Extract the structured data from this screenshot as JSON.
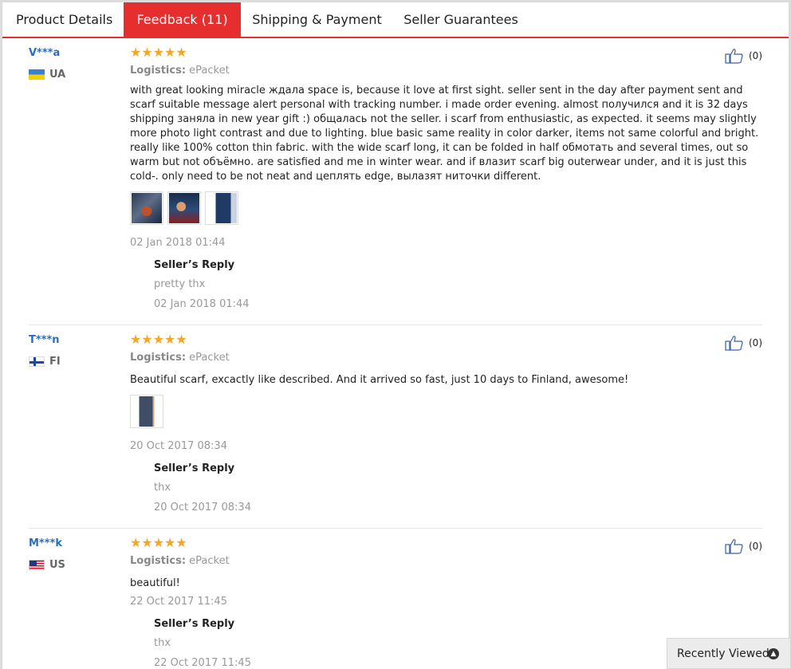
{
  "tabs": [
    {
      "label": "Product Details"
    },
    {
      "label": "Feedback (11)"
    },
    {
      "label": "Shipping & Payment"
    },
    {
      "label": "Seller Guarantees"
    }
  ],
  "reviews": [
    {
      "user": "V***a",
      "country": "UA",
      "stars": "★★★★★",
      "logistics_label": "Logistics:",
      "logistics_value": "ePacket",
      "text": "with great looking miracle ждала space is, because it love at first sight. seller sent in the day after payment sent and scarf suitable message alert personal with tracking number. i made order evening. almost получился and it is 32 days shipping заняла in new year gift :) общалась not the seller. i scarf from enthusiastic, as expected. it seems may slightly more photo light contrast and due to lighting. blue basic same reality in color darker, items not same colorful and bright. really like 100% cotton thin fabric. with the wide scarf long, it can be folded in half обмотать and several times, out so warm but not объёмно. are satisfied and me in winter wear. and if влазит scarf big outerwear under, and it is just this cold-. only need to be not neat and цеплять edge, вылазят ниточки different.",
      "date": "02 Jan 2018 01:44",
      "reply_title": "Seller’s Reply",
      "reply_text": "pretty thx",
      "reply_date": "02 Jan 2018 01:44",
      "helpful_count": "(0)"
    },
    {
      "user": "T***n",
      "country": "FI",
      "stars": "★★★★★",
      "logistics_label": "Logistics:",
      "logistics_value": "ePacket",
      "text": "Beautiful scarf, excactly like described. And it arrived so fast, just 10 days to Finland, awesome!",
      "date": "20 Oct 2017 08:34",
      "reply_title": "Seller’s Reply",
      "reply_text": "thx",
      "reply_date": "20 Oct 2017 08:34",
      "helpful_count": "(0)"
    },
    {
      "user": "M***k",
      "country": "US",
      "stars": "★★★★★",
      "logistics_label": "Logistics:",
      "logistics_value": "ePacket",
      "text": "beautiful!",
      "date": "22 Oct 2017 11:45",
      "reply_title": "Seller’s Reply",
      "reply_text": "thx",
      "reply_date": "22 Oct 2017 11:45",
      "helpful_count": "(0)"
    }
  ],
  "recently_viewed": {
    "label": "Recently Viewed",
    "icon": "chevron-up-circle-icon"
  },
  "colors": {
    "accent": "#e62e2e",
    "user_link": "#2a6ebb",
    "stars": "#f5a623"
  }
}
